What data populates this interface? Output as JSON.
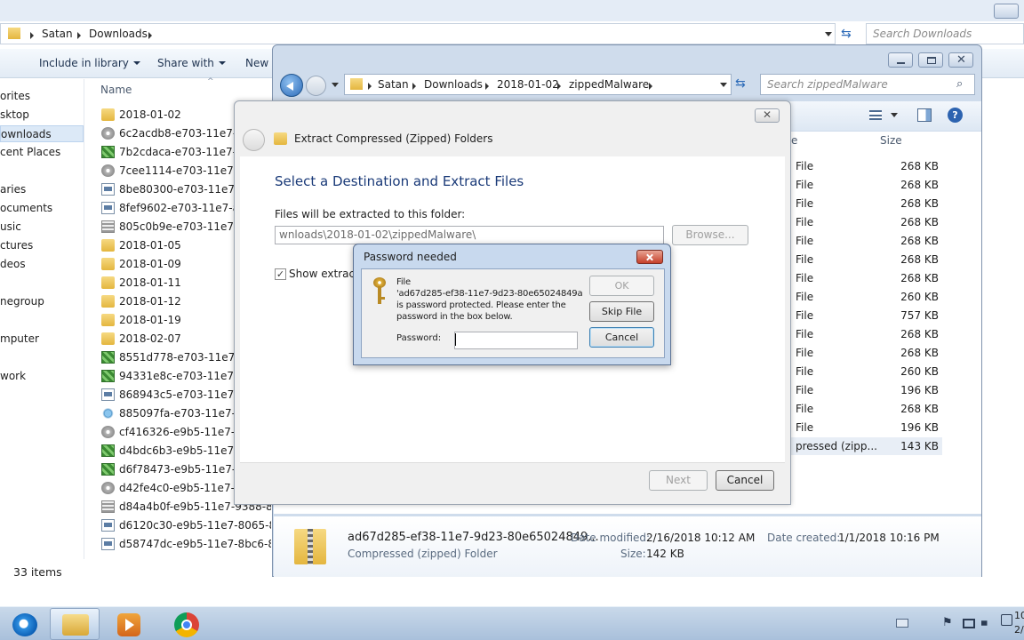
{
  "back_explorer": {
    "breadcrumb": [
      "Satan",
      "Downloads"
    ],
    "search_placeholder": "Search Downloads",
    "toolbar": {
      "include_library": "Include in library",
      "share_with": "Share with",
      "new_folder": "New f"
    },
    "nav": [
      "orites",
      "sktop",
      "ownloads",
      "cent Places",
      "aries",
      "ocuments",
      "usic",
      "ctures",
      "deos",
      "negroup",
      "mputer",
      "work"
    ],
    "column_name": "Name",
    "files": [
      {
        "name": "2018-01-02",
        "icon": "folder-icon"
      },
      {
        "name": "6c2acdb8-e703-11e7-a82",
        "icon": "disc-icon"
      },
      {
        "name": "7b2cdaca-e703-11e7-849",
        "icon": "zip-icon"
      },
      {
        "name": "7cee1114-e703-11e7-a40",
        "icon": "disc-icon"
      },
      {
        "name": "8be80300-e703-11e7-be4",
        "icon": "exe-icon"
      },
      {
        "name": "8fef9602-e703-11e7-a6e",
        "icon": "exe-icon"
      },
      {
        "name": "805c0b9e-e703-11e7-9ac",
        "icon": "pattern-icon"
      },
      {
        "name": "2018-01-05",
        "icon": "folder-icon"
      },
      {
        "name": "2018-01-09",
        "icon": "folder-icon"
      },
      {
        "name": "2018-01-11",
        "icon": "folder-icon"
      },
      {
        "name": "2018-01-12",
        "icon": "folder-icon"
      },
      {
        "name": "2018-01-19",
        "icon": "folder-icon"
      },
      {
        "name": "2018-02-07",
        "icon": "folder-icon"
      },
      {
        "name": "8551d778-e703-11e7-a17",
        "icon": "zip-icon"
      },
      {
        "name": "94331e8c-e703-11e7-a18",
        "icon": "zip-icon"
      },
      {
        "name": "868943c5-e703-11e7-b4a",
        "icon": "exe-icon"
      },
      {
        "name": "885097fa-e703-11e7-9da",
        "icon": "gear-icon"
      },
      {
        "name": "cf416326-e9b5-11e7-b01",
        "icon": "disc-icon"
      },
      {
        "name": "d4bdc6b3-e9b5-11e7-8a",
        "icon": "zip-icon"
      },
      {
        "name": "d6f78473-e9b5-11e7-9b6",
        "icon": "zip-icon"
      },
      {
        "name": "d42fe4c0-e9b5-11e7-968",
        "icon": "disc-icon"
      },
      {
        "name": "d84a4b0f-e9b5-11e7-9388-80e65",
        "icon": "pattern-icon"
      },
      {
        "name": "d6120c30-e9b5-11e7-8065-80e65",
        "icon": "exe-icon"
      },
      {
        "name": "d58747dc-e9b5-11e7-8bc6-80e65",
        "icon": "exe-icon"
      }
    ],
    "status": "33 items"
  },
  "zip_explorer": {
    "breadcrumb": [
      "Satan",
      "Downloads",
      "2018-01-02",
      "zippedMalware"
    ],
    "search_placeholder": "Search zippedMalware",
    "column_size": "Size",
    "column_type_partial": "e",
    "rows": [
      {
        "type": "File",
        "size": "268 KB"
      },
      {
        "type": "File",
        "size": "268 KB"
      },
      {
        "type": "File",
        "size": "268 KB"
      },
      {
        "type": "File",
        "size": "268 KB"
      },
      {
        "type": "File",
        "size": "268 KB"
      },
      {
        "type": "File",
        "size": "268 KB"
      },
      {
        "type": "File",
        "size": "268 KB"
      },
      {
        "type": "File",
        "size": "260 KB"
      },
      {
        "type": "File",
        "size": "757 KB"
      },
      {
        "type": "File",
        "size": "268 KB"
      },
      {
        "type": "File",
        "size": "268 KB"
      },
      {
        "type": "File",
        "size": "260 KB"
      },
      {
        "type": "File",
        "size": "196 KB"
      },
      {
        "type": "File",
        "size": "268 KB"
      },
      {
        "type": "File",
        "size": "196 KB"
      },
      {
        "type": "pressed (zipp...",
        "size": "143 KB"
      }
    ],
    "details": {
      "name": "ad67d285-ef38-11e7-9d23-80e65024849...",
      "kind": "Compressed (zipped) Folder",
      "modified_label": "Date modified:",
      "modified_value": "2/16/2018 10:12 AM",
      "created_label": "Date created:",
      "created_value": "1/1/2018 10:16 PM",
      "size_label": "Size:",
      "size_value": "142 KB"
    }
  },
  "wizard": {
    "title": "Extract Compressed (Zipped) Folders",
    "heading": "Select a Destination and Extract Files",
    "extract_label": "Files will be extracted to this folder:",
    "destination": "wnloads\\2018-01-02\\zippedMalware\\",
    "browse": "Browse...",
    "show_extracted": "Show extracte",
    "next": "Next",
    "cancel": "Cancel"
  },
  "password_dialog": {
    "title": "Password needed",
    "message_line1": "File",
    "message_line2": "'ad67d285-ef38-11e7-9d23-80e65024849a",
    "message_line3": "is password protected.  Please enter the",
    "message_line4": "password in the box below.",
    "password_label": "Password:",
    "password_value": "",
    "ok": "OK",
    "skip_file": "Skip File",
    "cancel": "Cancel"
  },
  "taskbar": {
    "apps": [
      "internet-explorer-icon",
      "file-explorer-icon",
      "media-player-icon",
      "chrome-icon"
    ],
    "clock_partial_1": "10",
    "clock_partial_2": "2/"
  },
  "colors": {
    "accent": "#2b6ab8",
    "selection": "#dce9f7",
    "close_red": "#c6402a"
  }
}
